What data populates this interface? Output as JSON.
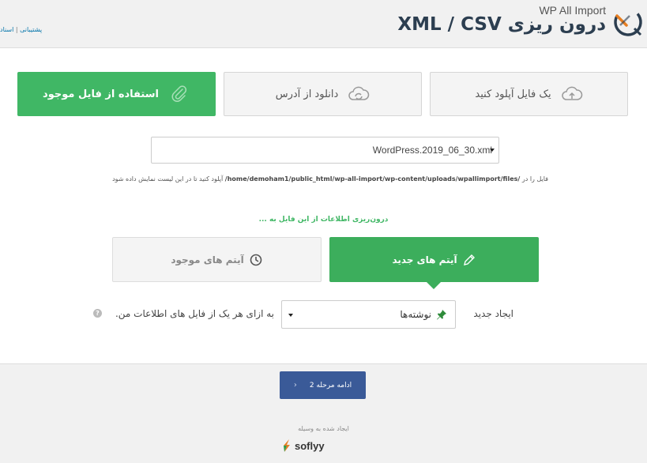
{
  "header": {
    "brand_small": "WP All Import",
    "title": "XML / CSV درون ریزی",
    "links": {
      "support": "پشتیبانی",
      "separator": "|",
      "docs": "اسناد"
    }
  },
  "source_buttons": {
    "upload": {
      "label": "یک فایل آپلود کنید",
      "icon": "cloud-upload-icon"
    },
    "url": {
      "label": "دانلود از آدرس",
      "icon": "cloud-sync-icon"
    },
    "existing": {
      "label": "استفاده از فایل موجود",
      "icon": "paperclip-icon"
    }
  },
  "file_select": {
    "value": "WordPress.2019_06_30.xml"
  },
  "path_hint": {
    "prefix": "فایل را در",
    "path": "/home/demoham1/public_html/wp-all-import/wp-content/uploads/wpallimport/files/",
    "suffix": "آپلود کنید تا در این لیست نمایش داده شود"
  },
  "import_hint": "درون‌ریزی اطلاعات از این فایل به ...",
  "mode": {
    "new_items": "آیتم های جدید",
    "existing_items": "آیتم های موجود"
  },
  "create": {
    "label": "ایجاد جدید",
    "post_type": "نوشته‌ها",
    "per_record": "به ازای هر یک از فایل های اطلاعات من.",
    "help": "?"
  },
  "footer": {
    "continue": "ادامه مرحله 2",
    "continue_chevron": "‹",
    "created_by": "ایجاد شده به وسیله",
    "company": "soflyy"
  },
  "colors": {
    "green": "#40b765",
    "blue": "#3a5a98",
    "title": "#2c3e50",
    "link": "#0073aa"
  }
}
